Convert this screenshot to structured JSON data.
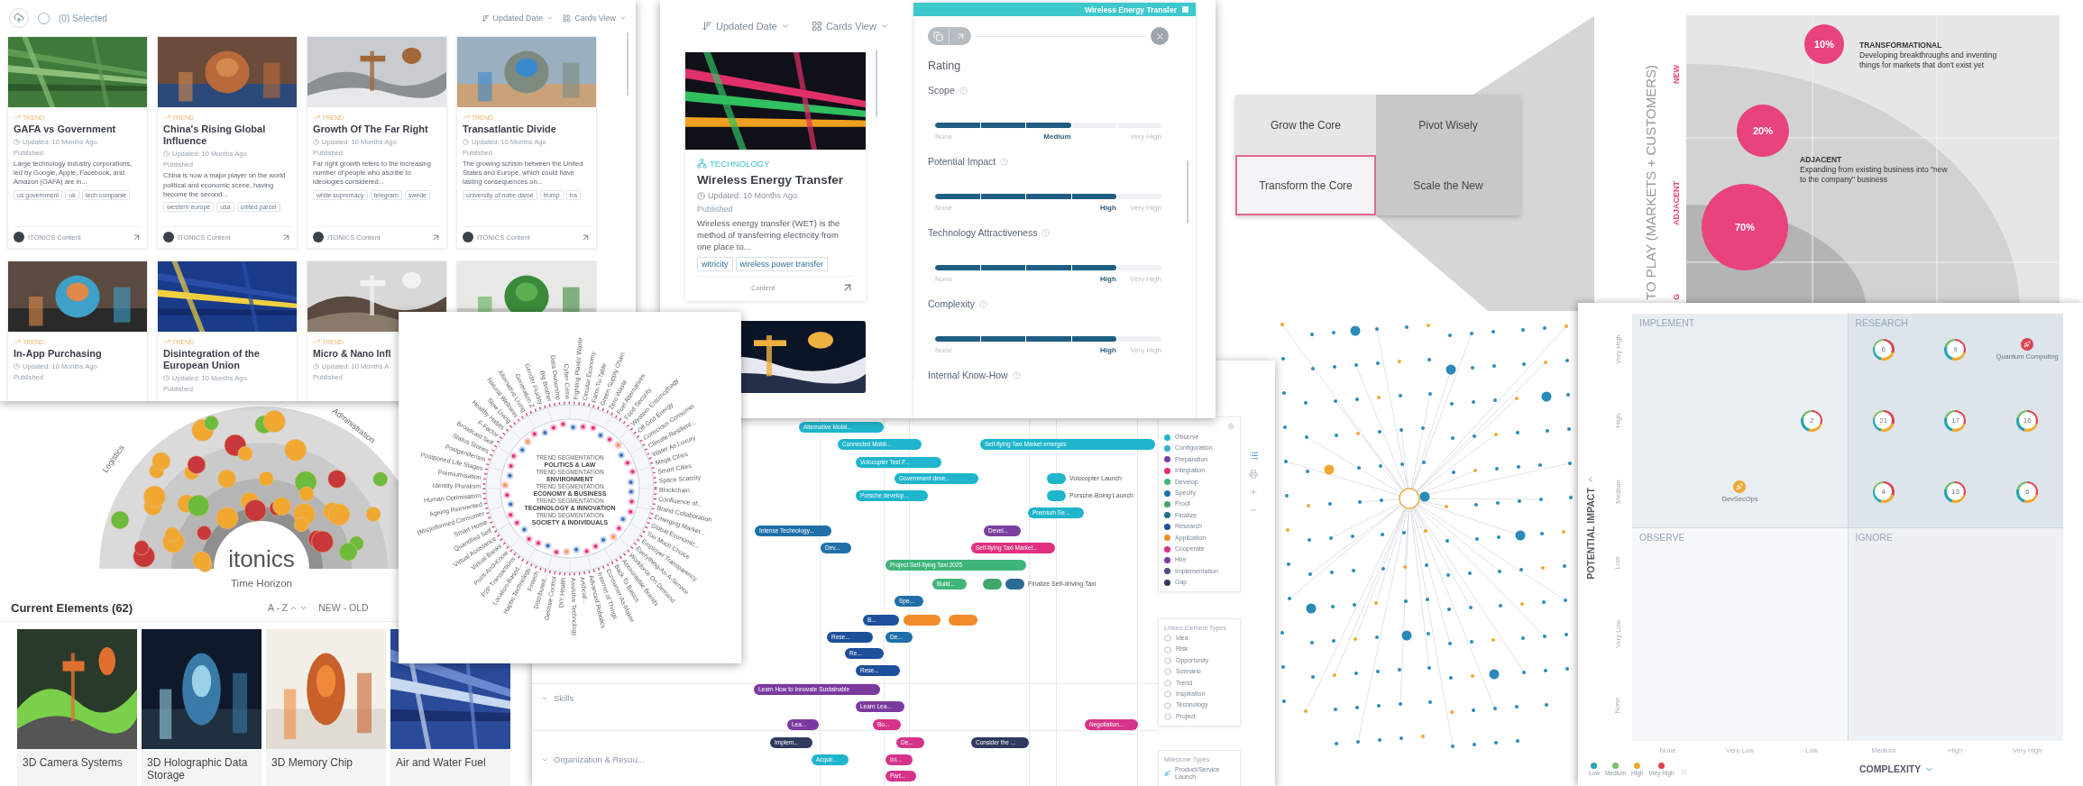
{
  "card_grid": {
    "all_checked": false,
    "selection": "(0) Selected",
    "sort": "Updated Date",
    "view": "Cards View",
    "cards": [
      {
        "type": "TREND",
        "title": "GAFA vs Government",
        "updated": "Updated: 10 Months Ago",
        "status": "Published",
        "description": "Large technology industry corporations, led by Google, Apple, Facebook, and Amazon (GAFA) are in...",
        "tags": [
          "us government",
          "uk",
          "tech companie"
        ],
        "author": "ITONICS Content"
      },
      {
        "type": "TREND",
        "title": "China's Rising Global Influence",
        "updated": "Updated: 10 Months Ago",
        "status": "Published",
        "description": "China is now a major player on the world political and economic scene, having become the second...",
        "tags": [
          "western europe",
          "usa",
          "united parcel"
        ],
        "author": "ITONICS Content"
      },
      {
        "type": "TREND",
        "title": "Growth Of The Far Right",
        "updated": "Updated: 10 Months Ago",
        "status": "Published",
        "description": "Far right growth refers to the increasing number of people who ascribe to ideologies considered...",
        "tags": [
          "white supremacy",
          "telegram",
          "swede"
        ],
        "author": "ITONICS Content"
      },
      {
        "type": "TREND",
        "title": "Transatlantic Divide",
        "updated": "Updated: 10 Months Ago",
        "status": "Published",
        "description": "The growing schism between the United States and Europe, which could have lasting consequences on...",
        "tags": [
          "university of notre dame",
          "trump",
          "tra"
        ],
        "author": "ITONICS Content"
      }
    ],
    "more_cards": [
      {
        "kind": "card",
        "type": "TREND",
        "title": "In-App Purchasing",
        "updated": "Updated: 10 Months Ago",
        "status": "Published"
      },
      {
        "kind": "card",
        "type": "TREND",
        "title": "Disintegration of the European Union",
        "updated": "Updated: 10 Months Ago",
        "status": "Published"
      },
      {
        "kind": "card",
        "type": "TREND",
        "title": "Micro & Nano Infl",
        "updated": "Updated: 10 Months A",
        "status": "Published"
      },
      {
        "kind": "picture"
      }
    ]
  },
  "card_list": {
    "sort": "Updated Date",
    "view": "Cards View",
    "card": {
      "category": "TECHNOLOGY",
      "title": "Wireless Energy Transfer",
      "updated": "Updated: 10 Months Ago",
      "status": "Published",
      "description": "Wireless energy transfer (WET) is the method of transferring electricity from one place to...",
      "tags": [
        "witricity",
        "wireless power transfer"
      ],
      "author": "Content"
    }
  },
  "detail": {
    "title": "Wireless Energy Transfer",
    "section": "Rating",
    "ratings": [
      {
        "name": "Scope",
        "level": 0.6,
        "min": "None",
        "reading": "Medium",
        "max": "Very High"
      },
      {
        "name": "Potential Impact",
        "level": 0.8,
        "min": "None",
        "reading": "High",
        "max": "Very High"
      },
      {
        "name": "Technology Attractiveness",
        "level": 0.8,
        "min": "None",
        "reading": "High",
        "max": "Very High"
      },
      {
        "name": "Complexity",
        "level": 0.8,
        "min": "None",
        "reading": "High",
        "max": "Very High"
      },
      {
        "name": "Internal Know-How"
      }
    ]
  },
  "radar": {
    "labels": [
      "Logistics",
      "Administration"
    ],
    "logo": "itonics",
    "axis": "Time Horizon",
    "heading": "Current Elements (62)",
    "sort": "A - Z",
    "order": "NEW - OLD",
    "items": [
      "3D Camera Systems",
      "3D Holographic Data Storage",
      "3D Memory Chip",
      "Air and Water Fuel"
    ]
  },
  "radial": {
    "segments": [
      {
        "caption": "TREND SEGMENTATION",
        "title": "POLITICS & LAW"
      },
      {
        "caption": "TREND SEGMENTATION",
        "title": "ENVIRONMENT"
      },
      {
        "caption": "TREND SEGMENTATION",
        "title": "ECONOMY & BUSINESS"
      },
      {
        "caption": "TREND SEGMENTATION",
        "title": "TECHNOLOGY & INNOVATION"
      },
      {
        "caption": "TREND SEGMENTATION",
        "title": "SOCIETY & INDIVIDUALS"
      }
    ],
    "labels": [
      "Fighting Plastic Waste",
      "Circular Economy",
      "Farm-To-Table",
      "Green Supply Chain",
      "Zero Waste",
      "Fuel Alternatives",
      "Food Security",
      "Western Entomophagy",
      "Off Grid Energy",
      "Conscious Consumer",
      "Climate-Resilient...",
      "Water As Luxury",
      "Mega Cities",
      "Smart Cities",
      "Space Scarcity",
      "Blockchain",
      "Confluence of...",
      "Brand Collaboration",
      "Emerging Market...",
      "Global Economic...",
      "Too Much Choice",
      "Employer Transparency",
      "Everything-As-A-Service",
      "Workforce On Demand",
      "Accountable Brands",
      "Back To Basics",
      "Consumer-As-Maker",
      "Internet of Things",
      "Advanced Robotics",
      "Artificial...",
      "Assistive Technology",
      "DIY Health",
      "Gesture Control",
      "Distributed...",
      "Fintech",
      "Haptic Technology",
      "Location-Based...",
      "P2P Transactions",
      "Point-And-Know",
      "Virtual Banks",
      "Virtual Assistance",
      "Quantified Self",
      "Smart Home",
      "(Mis)informed Consumer",
      "Ageing Reinvented",
      "Human Optimisation",
      "Identity Pluralism",
      "Premiumisation",
      "Postponed Life Stages",
      "Postgenderism",
      "Status Stories",
      "Broadcast Self",
      "F-Factor",
      "Healthy Habits",
      "Slow Living",
      "Natural Wellness",
      "Alternative Living",
      "Generation Z",
      "Gender Fluidity",
      "Big Brother",
      "Data Ownership",
      "Cyber Crime"
    ]
  },
  "roadmap": {
    "rows": [
      "Skills",
      "Organization & Resou..."
    ],
    "bars": [
      {
        "label": "Alternative Mobil...",
        "color": "#1fb5cc"
      },
      {
        "label": "Connected Mobil...",
        "color": "#1fb5cc"
      },
      {
        "label": "Self-flying Taxi Market emerges",
        "color": "#1fb5cc"
      },
      {
        "label": "Volocopter Test F...",
        "color": "#1fb5cc"
      },
      {
        "label": "Government deve...",
        "color": "#1fb5cc"
      },
      {
        "outside": "Volocopter Launch",
        "color": "#1fb5cc"
      },
      {
        "label": "Porsche develop...",
        "color": "#1fb5cc"
      },
      {
        "outside": "Porsche-Boing Launch",
        "color": "#1fb5cc"
      },
      {
        "label": "Premium Se...",
        "color": "#1fb5cc"
      },
      {
        "label": "Intense Technology...",
        "color": "#1f6fa8"
      },
      {
        "label": "Devel...",
        "color": "#7b3f9e"
      },
      {
        "label": "Dev...",
        "color": "#1f6fa8"
      },
      {
        "label": "Self-flying Taxi Market...",
        "color": "#e0307f"
      },
      {
        "label": "Project Self-flying Taxi 2025",
        "color": "#3fb57a"
      },
      {
        "label": "Build...",
        "color": "#3fb57a"
      },
      {
        "color": "#3fa86a"
      },
      {
        "outside": "Finalize Self-driving Taxi",
        "color": "#2a6b8f"
      },
      {
        "label": "Spe...",
        "color": "#1f6fa8"
      },
      {
        "label": "B...",
        "color": "#1e4f9a"
      },
      {
        "color": "#f28c28"
      },
      {
        "color": "#f28c28"
      },
      {
        "label": "Rese...",
        "color": "#1e4f9a"
      },
      {
        "label": "De...",
        "color": "#1f6fa8"
      },
      {
        "label": "Re...",
        "color": "#1e4f9a"
      },
      {
        "label": "Rese...",
        "color": "#1e4f9a"
      },
      {
        "label": "Learn How to Innovate Sustainable",
        "color": "#7b3aa0"
      },
      {
        "label": "Learn Lea...",
        "color": "#7b3aa0"
      },
      {
        "label": "Lea...",
        "color": "#7b3aa0"
      },
      {
        "label": "Bo...",
        "color": "#d6338a"
      },
      {
        "label": "Negotiation...",
        "color": "#d6338a"
      },
      {
        "label": "Implem...",
        "color": "#2e3b5e"
      },
      {
        "label": "De...",
        "color": "#d6338a"
      },
      {
        "label": "Consider the ...",
        "color": "#2e3b5e"
      },
      {
        "label": "Acquir...",
        "color": "#1fb5cc"
      },
      {
        "label": "Ini...",
        "color": "#d6338a"
      },
      {
        "label": "Part...",
        "color": "#d6338a"
      }
    ],
    "phases": [
      {
        "label": "Observe",
        "color": "#1fb5cc"
      },
      {
        "label": "Configuration",
        "color": "#2fb3c7"
      },
      {
        "label": "Preparation",
        "color": "#7b3f9e"
      },
      {
        "label": "Integration",
        "color": "#e0307f"
      },
      {
        "label": "Develop",
        "color": "#3fb57a"
      },
      {
        "label": "Specify",
        "color": "#1f6fa8"
      },
      {
        "label": "Proof",
        "color": "#3fa86a"
      },
      {
        "label": "Finalize",
        "color": "#2a6b8f"
      },
      {
        "label": "Research",
        "color": "#1e4f9a"
      },
      {
        "label": "Application",
        "color": "#f28c28"
      },
      {
        "label": "Cooperate",
        "color": "#d6338a"
      },
      {
        "label": "Hire",
        "color": "#7b3aa0"
      },
      {
        "label": "Implementation",
        "color": "#4b4f8a"
      },
      {
        "label": "Gap",
        "color": "#2e3b5e"
      }
    ],
    "linked_title": "Linked Element Types",
    "linked": [
      "Idea",
      "Risk",
      "Opportunity",
      "Scenario",
      "Trend",
      "Inspiration",
      "Technology",
      "Project"
    ],
    "milestone_title": "Milestone Types",
    "milestones": [
      "Product/Service Launch"
    ]
  },
  "portfolio": {
    "cells": [
      {
        "label": "Grow the Core",
        "selected": false
      },
      {
        "label": "Pivot Wisely",
        "selected": false
      },
      {
        "label": "Transform the Core",
        "selected": true
      },
      {
        "label": "Scale the New",
        "selected": false
      }
    ]
  },
  "ambition": {
    "axis": "TO PLAY (MARKETS + CUSTOMERS)",
    "levels": [
      "NEW",
      "ADJACENT",
      "G"
    ],
    "bubbles": [
      {
        "value": "10%"
      },
      {
        "value": "20%"
      },
      {
        "value": "70%"
      }
    ],
    "notes": [
      {
        "title": "TRANSFORMATIONAL",
        "text": "Developing breakthroughs and inventing things for markets that don't exist yet"
      },
      {
        "title": "ADJACENT",
        "text": "Expanding from existing business into \"new to the company\" business"
      }
    ]
  },
  "matrix": {
    "y_title": "POTENTIAL IMPACT",
    "x_title": "COMPLEXITY",
    "quadrants": [
      "IMPLEMENT",
      "RESEARCH",
      "OBSERVE",
      "IGNORE"
    ],
    "rows": [
      {
        "label": "Very High",
        "cells": [
          {
            "kind": "empty"
          },
          {
            "kind": "empty"
          },
          {
            "kind": "empty"
          },
          {
            "kind": "ring",
            "count": "6"
          },
          {
            "kind": "ring",
            "count": "9"
          },
          {
            "kind": "item",
            "label": "Quantum Computing",
            "color": "#d9434e"
          }
        ]
      },
      {
        "label": "High",
        "cells": [
          {
            "kind": "empty"
          },
          {
            "kind": "empty"
          },
          {
            "kind": "ring",
            "count": "2"
          },
          {
            "kind": "ring",
            "count": "21"
          },
          {
            "kind": "ring",
            "count": "17"
          },
          {
            "kind": "ring",
            "count": "16"
          }
        ]
      },
      {
        "label": "Medium",
        "cells": [
          {
            "kind": "empty"
          },
          {
            "kind": "item",
            "label": "DevSecOps",
            "color": "#f0a830"
          },
          {
            "kind": "empty"
          },
          {
            "kind": "ring",
            "count": "4"
          },
          {
            "kind": "ring",
            "count": "13"
          },
          {
            "kind": "ring",
            "count": "6"
          }
        ]
      },
      {
        "label": "Low"
      },
      {
        "label": "Very Low"
      },
      {
        "label": "None"
      }
    ],
    "columns": [
      "None",
      "Very Low",
      "Low",
      "Medium",
      "High",
      "Very High"
    ],
    "legend": [
      {
        "label": "Low",
        "color": "#2aa5b0"
      },
      {
        "label": "Medium",
        "color": "#7bbf6a"
      },
      {
        "label": "High",
        "color": "#f0a830"
      },
      {
        "label": "Very High",
        "color": "#d9434e"
      }
    ]
  }
}
